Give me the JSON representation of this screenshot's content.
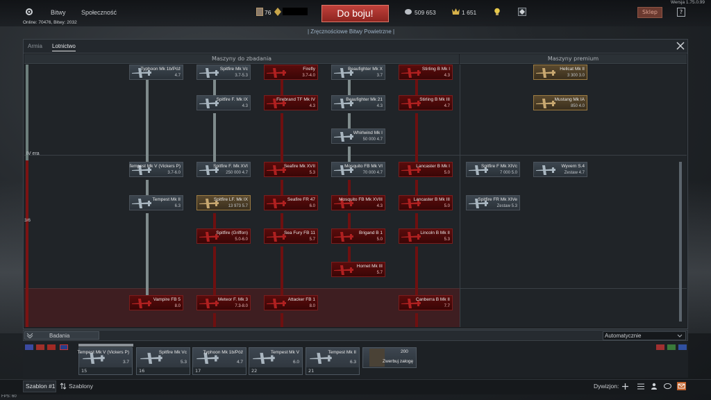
{
  "version": "Wersja 1.75.0.99",
  "fps": "FPS: 60",
  "topbar": {
    "nav_bitwy": "Bitwy",
    "nav_spolecznosc": "Społeczność",
    "online": "Online: 70476, Bitwy: 2032",
    "level": "76",
    "battle_button": "Do boju!",
    "mode": "| Zręcznościowe Bitwy Powietrzne |",
    "silver_lions": "509 653",
    "golden_eagles": "1 651",
    "shop": "Sklep",
    "help": "?"
  },
  "tabs": [
    "Armia",
    "Lotnictwo"
  ],
  "sections": {
    "research": "Maszyny do zbadania",
    "premium": "Maszyny premium"
  },
  "era_labels": {
    "era": "IV era",
    "progress": "3/6"
  },
  "tree": [
    {
      "name": "Typhoon Mk 1b/Póź",
      "br": "4.7",
      "style": "g",
      "col": 0,
      "row": 0
    },
    {
      "name": "Spitfire Mk Vc",
      "br": "3.7-5.3",
      "style": "g",
      "col": 1,
      "row": 0
    },
    {
      "name": "Firefly",
      "br": "3.7-4.0",
      "style": "r",
      "col": 2,
      "row": 0
    },
    {
      "name": "Beaufighter Mk X",
      "br": "3.7",
      "style": "g",
      "col": 3,
      "row": 0
    },
    {
      "name": "Stirling B Mk I",
      "br": "4.3",
      "style": "r",
      "col": 4,
      "row": 0
    },
    {
      "name": "Hellcat Mk II",
      "br": "3.0",
      "cost": "3 300",
      "style": "y",
      "col": 6,
      "row": 0
    },
    {
      "name": "Spitfire F. Mk IX",
      "br": "4.3",
      "style": "g",
      "col": 1,
      "row": 1
    },
    {
      "name": "Firebrand TF Mk IV",
      "br": "4.3",
      "style": "r",
      "col": 2,
      "row": 1
    },
    {
      "name": "Beaufighter Mk 21",
      "br": "4.3",
      "style": "g",
      "col": 3,
      "row": 1
    },
    {
      "name": "Stirling B Mk III",
      "br": "4.7",
      "style": "r",
      "col": 4,
      "row": 1
    },
    {
      "name": "Mustang Mk IA",
      "br": "4.0",
      "cost": "850",
      "style": "y",
      "col": 6,
      "row": 1
    },
    {
      "name": "Whirlwind Mk I",
      "br": "4.7",
      "cost": "50 000",
      "style": "g",
      "col": 3,
      "row": 2
    },
    {
      "name": "Tempest Mk V (Vickers P)",
      "br": "3.7-6.0",
      "style": "g",
      "col": 0,
      "row": 3
    },
    {
      "name": "Spitfire F. Mk XVI",
      "br": "4.7",
      "cost": "250 000",
      "style": "g",
      "col": 1,
      "row": 3
    },
    {
      "name": "Seafire Mk XVII",
      "br": "5.3",
      "style": "r",
      "col": 2,
      "row": 3
    },
    {
      "name": "Mosquito FB Mk VI",
      "br": "4.7",
      "cost": "70 000",
      "style": "g",
      "col": 3,
      "row": 3
    },
    {
      "name": "Lancaster B Mk I",
      "br": "5.0",
      "style": "r",
      "col": 4,
      "row": 3
    },
    {
      "name": "Spitfire F Mk XIVc",
      "br": "5.0",
      "cost": "7 000",
      "style": "g",
      "col": 5,
      "row": 3
    },
    {
      "name": "Wyvern S.4",
      "br": "4.7",
      "sub": "Zestaw",
      "style": "g",
      "col": 6,
      "row": 3
    },
    {
      "name": "Tempest Mk II",
      "br": "6.3",
      "style": "g",
      "col": 0,
      "row": 4
    },
    {
      "name": "Spitfire LF. Mk IX",
      "br": "5.7",
      "cost": "13 973",
      "style": "y",
      "col": 1,
      "row": 4
    },
    {
      "name": "Seafire FR 47",
      "br": "6.0",
      "style": "r",
      "col": 2,
      "row": 4
    },
    {
      "name": "Mosquito FB Mk XVIII",
      "br": "4.3",
      "style": "r",
      "col": 3,
      "row": 4
    },
    {
      "name": "Lancaster B Mk III",
      "br": "5.0",
      "style": "r",
      "col": 4,
      "row": 4
    },
    {
      "name": "Spitfire FR Mk XIVe",
      "br": "5.3",
      "sub": "Zestaw",
      "style": "g",
      "col": 5,
      "row": 4
    },
    {
      "name": "Spitfire (Griffon)",
      "br": "5.0-6.0",
      "style": "r",
      "col": 1,
      "row": 5
    },
    {
      "name": "Sea Fury FB 11",
      "br": "5.7",
      "style": "r",
      "col": 2,
      "row": 5
    },
    {
      "name": "Brigand B 1",
      "br": "5.0",
      "style": "r",
      "col": 3,
      "row": 5
    },
    {
      "name": "Lincoln B Mk II",
      "br": "5.3",
      "style": "r",
      "col": 4,
      "row": 5
    },
    {
      "name": "Hornet Mk III",
      "br": "5.7",
      "style": "r",
      "col": 3,
      "row": 6
    },
    {
      "name": "Vampire FB 5",
      "br": "8.0",
      "style": "r",
      "col": 0,
      "row": 7
    },
    {
      "name": "Meteor F. Mk 3",
      "br": "7.3-8.0",
      "style": "r",
      "col": 1,
      "row": 7
    },
    {
      "name": "Attacker FB 1",
      "br": "8.0",
      "style": "r",
      "col": 2,
      "row": 7
    },
    {
      "name": "Canberra B Mk II",
      "br": "7.7",
      "style": "r",
      "col": 4,
      "row": 7
    }
  ],
  "research_bar": {
    "label": "Badania",
    "dropdown": "Automatycznie"
  },
  "crew": [
    {
      "name": "Tempest Mk V (Vickers P)",
      "br": "3.7",
      "num": "15"
    },
    {
      "name": "Spitfire Mk Vc",
      "br": "5.3",
      "num": "16"
    },
    {
      "name": "Typhoon Mk 1b/Póź",
      "br": "4.7",
      "num": "17"
    },
    {
      "name": "Tempest Mk V",
      "br": "6.0",
      "num": "22"
    },
    {
      "name": "Tempest Mk II",
      "br": "6.3",
      "num": "21"
    }
  ],
  "recruit": {
    "cost": "200",
    "label": "Zwerbuj załogę"
  },
  "footer": {
    "preset": "Szablon #1",
    "presets": "Szablony",
    "squadron": "Dywizjon:"
  },
  "colors": {
    "accent_red": "#c0413b",
    "premium_gold": "#9c7b42",
    "researched": "#3c464f",
    "locked": "#5a0c0c"
  }
}
